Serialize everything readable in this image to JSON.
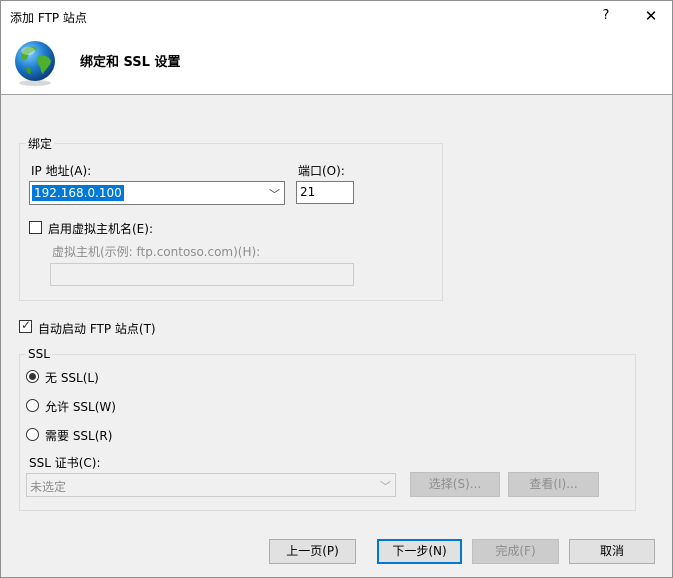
{
  "window": {
    "title": "添加 FTP 站点",
    "help_glyph": "?",
    "close_glyph": "✕"
  },
  "header": {
    "heading": "绑定和 SSL 设置"
  },
  "binding": {
    "group_label": "绑定",
    "ip_label": "IP 地址(A):",
    "ip_value": "192.168.0.100",
    "port_label": "端口(O):",
    "port_value": "21",
    "virtual_host_checkbox_label": "启用虚拟主机名(E):",
    "virtual_host_checked": false,
    "virtual_host_label": "虚拟主机(示例: ftp.contoso.com)(H):",
    "virtual_host_value": ""
  },
  "autostart": {
    "label": "自动启动 FTP 站点(T)",
    "checked": true
  },
  "ssl": {
    "group_label": "SSL",
    "options": [
      "无 SSL(L)",
      "允许 SSL(W)",
      "需要 SSL(R)"
    ],
    "selected_index": 0,
    "cert_label": "SSL 证书(C):",
    "cert_value": "未选定",
    "select_button": "选择(S)...",
    "view_button": "查看(I)..."
  },
  "footer": {
    "prev_button": "上一页(P)",
    "next_button": "下一步(N)",
    "finish_button": "完成(F)",
    "cancel_button": "取消"
  },
  "icons": {
    "header_icon": "globe-icon",
    "dropdown_icon": "chevron-down-icon"
  },
  "colors": {
    "selection": "#0078d7",
    "dialog_bg": "#f0f0f0"
  }
}
